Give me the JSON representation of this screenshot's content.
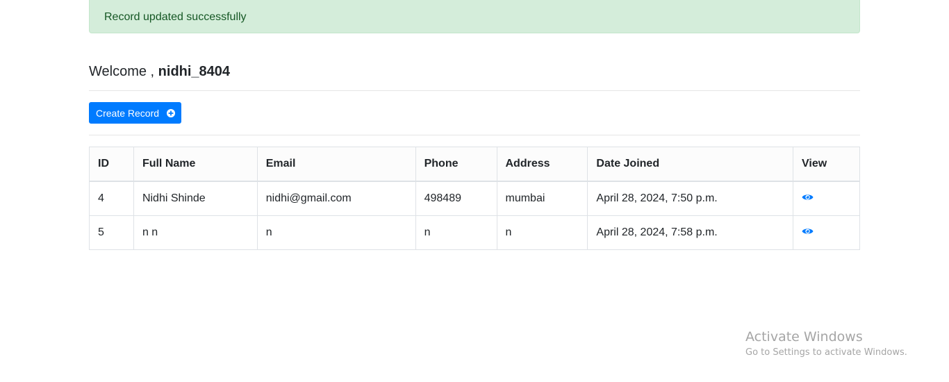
{
  "alert": {
    "message": "Record updated successfully",
    "color": "#d4edda"
  },
  "welcome": {
    "prefix": "Welcome , ",
    "username": "nidhi_8404"
  },
  "toolbar": {
    "create_label": "Create Record",
    "create_icon": "plus-circle-icon",
    "accent": "#007bff"
  },
  "table": {
    "headers": [
      "ID",
      "Full Name",
      "Email",
      "Phone",
      "Address",
      "Date Joined",
      "View"
    ],
    "rows": [
      {
        "id": "4",
        "full_name": "Nidhi Shinde",
        "email": "nidhi@gmail.com",
        "phone": "498489",
        "address": "mumbai",
        "date_joined": "April 28, 2024, 7:50 p.m.",
        "view_icon": "eye-icon"
      },
      {
        "id": "5",
        "full_name": "n n",
        "email": "n",
        "phone": "n",
        "address": "n",
        "date_joined": "April 28, 2024, 7:58 p.m.",
        "view_icon": "eye-icon"
      }
    ]
  },
  "watermark": {
    "title": "Activate Windows",
    "subtitle": "Go to Settings to activate Windows."
  }
}
